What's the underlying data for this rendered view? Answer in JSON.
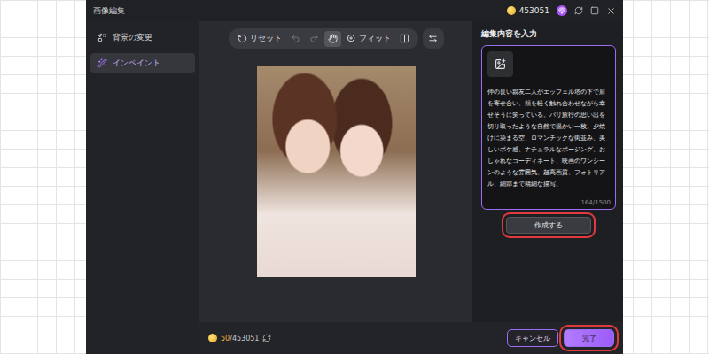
{
  "window": {
    "title": "画像編集",
    "credits": "453051"
  },
  "sidebar": {
    "items": [
      {
        "label": "背景の変更",
        "kind": "background",
        "selected": false
      },
      {
        "label": "インペイント",
        "kind": "inpaint",
        "selected": true
      }
    ]
  },
  "toolbar": {
    "tools": [
      {
        "kind": "reset",
        "label": "リセット",
        "selected": false,
        "disabled": false
      },
      {
        "kind": "undo",
        "selected": false,
        "disabled": true
      },
      {
        "kind": "redo",
        "selected": false,
        "disabled": true
      },
      {
        "kind": "hand",
        "selected": true,
        "disabled": false
      },
      {
        "kind": "zoom",
        "label": "フィット",
        "selected": false,
        "disabled": false
      },
      {
        "kind": "compare",
        "selected": false,
        "disabled": false
      }
    ]
  },
  "prompt": {
    "label": "編集内容を入力",
    "text": "仲の良い親友二人がエッフェル塔の下で肩を寄せ合い、頬を軽く触れ合わせながら幸せそうに笑っている。パリ旅行の思い出を切り取ったような自然で温かい一枚。夕焼けに染まる空、ロマンチックな街並み、美しいボケ感、ナチュラルなポージング、おしゃれなコーディネート、映画のワンシーンのような雰囲気、超高画質、フォトリアル、細部まで精細な描写。",
    "counter": "164/1500"
  },
  "generate_button": {
    "label": "作成する",
    "highlighted": true
  },
  "footer": {
    "cost": "50",
    "balance": "/453051",
    "buttons": [
      {
        "label": "キャンセル",
        "kind": "secondary",
        "highlighted": false
      },
      {
        "label": "完了",
        "kind": "primary",
        "highlighted": true
      }
    ]
  }
}
